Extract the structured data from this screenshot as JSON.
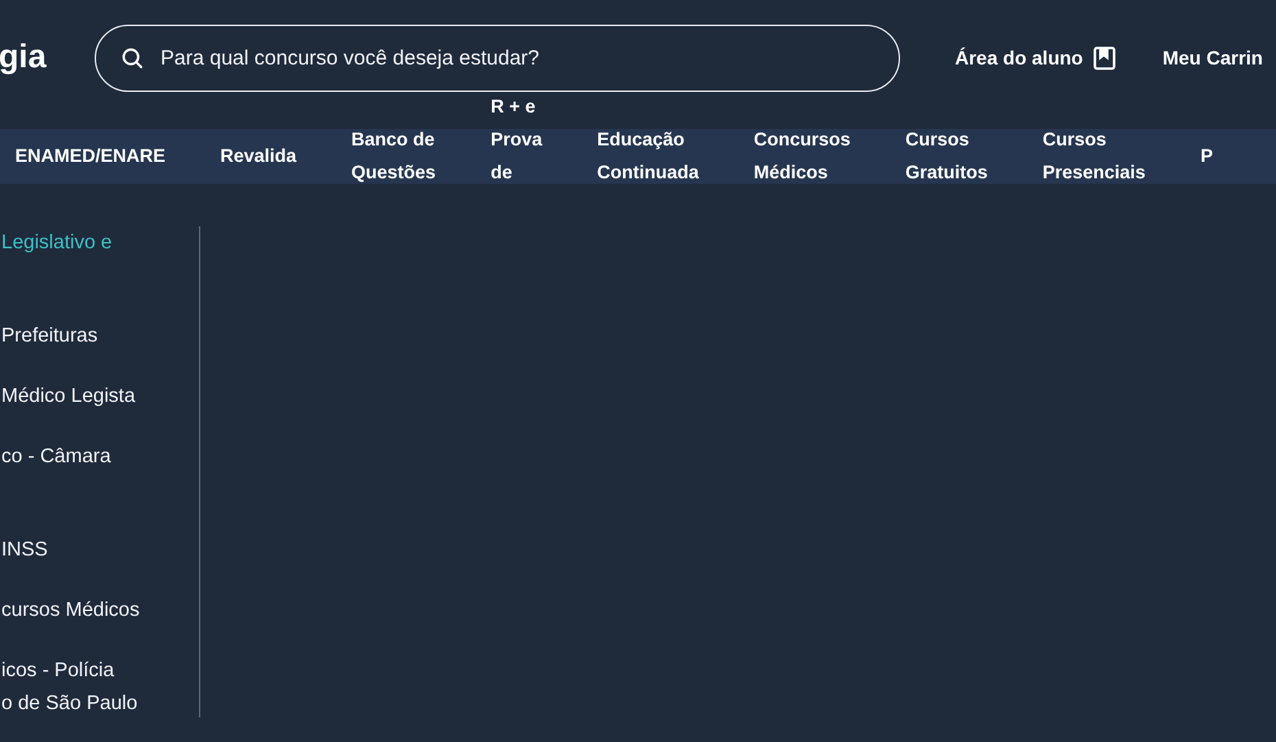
{
  "header": {
    "logo": "gia",
    "search": {
      "placeholder": "Para qual concurso você deseja estudar?"
    },
    "links": [
      {
        "label": "Área do aluno",
        "kind": "student"
      },
      {
        "label": "Meu Carrin",
        "kind": "cart"
      }
    ]
  },
  "nav": {
    "items": [
      {
        "lines": [
          "ENAMED/ENARE"
        ]
      },
      {
        "lines": [
          "Revalida"
        ]
      },
      {
        "lines": [
          "Banco de",
          "Questões"
        ]
      },
      {
        "lines": [
          "R + e",
          "Prova",
          "de"
        ]
      },
      {
        "lines": [
          "Educação",
          "Continuada"
        ]
      },
      {
        "lines": [
          "Concursos",
          "Médicos"
        ]
      },
      {
        "lines": [
          "Cursos",
          "Gratuitos"
        ]
      },
      {
        "lines": [
          "Cursos",
          "Presenciais"
        ]
      },
      {
        "lines": [
          "P"
        ]
      }
    ]
  },
  "sidebar": {
    "items": [
      {
        "lines": [
          "Legislativo e"
        ],
        "selected": true,
        "wraps": true
      },
      {
        "lines": [
          "Prefeituras"
        ],
        "selected": false,
        "wraps": false
      },
      {
        "lines": [
          "Médico Legista"
        ],
        "selected": false,
        "wraps": false
      },
      {
        "lines": [
          "co - Câmara"
        ],
        "selected": false,
        "wraps": true
      },
      {
        "lines": [
          "INSS"
        ],
        "selected": false,
        "wraps": false
      },
      {
        "lines": [
          "cursos Médicos"
        ],
        "selected": false,
        "wraps": false
      },
      {
        "lines": [
          "icos - Polícia",
          "o de São Paulo"
        ],
        "selected": false,
        "wraps": false
      }
    ]
  }
}
